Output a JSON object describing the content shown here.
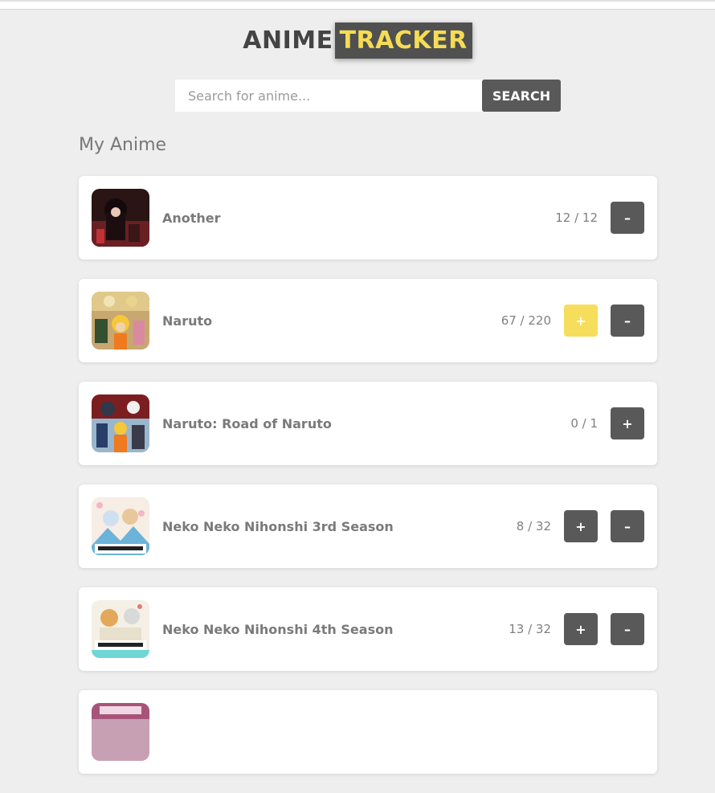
{
  "logo": {
    "part1": "ANIME",
    "part2": "TRACKER"
  },
  "search": {
    "placeholder": "Search for anime...",
    "value": "",
    "button_label": "SEARCH"
  },
  "section": {
    "title": "My Anime"
  },
  "colors": {
    "accent_yellow": "#f7dd5c",
    "button_dark": "#595959",
    "background": "#eeeeee"
  },
  "anime": [
    {
      "title": "Another",
      "progress": "12 / 12",
      "plus": "",
      "minus": "–"
    },
    {
      "title": "Naruto",
      "progress": "67 / 220",
      "plus": "+",
      "minus": "–"
    },
    {
      "title": "Naruto: Road of Naruto",
      "progress": "0 / 1",
      "plus": "+",
      "minus": ""
    },
    {
      "title": "Neko Neko Nihonshi 3rd Season",
      "progress": "8 / 32",
      "plus": "+",
      "minus": "–"
    },
    {
      "title": "Neko Neko Nihonshi 4th Season",
      "progress": "13 / 32",
      "plus": "+",
      "minus": "–"
    },
    {
      "title": "",
      "progress": "",
      "plus": "",
      "minus": ""
    }
  ]
}
